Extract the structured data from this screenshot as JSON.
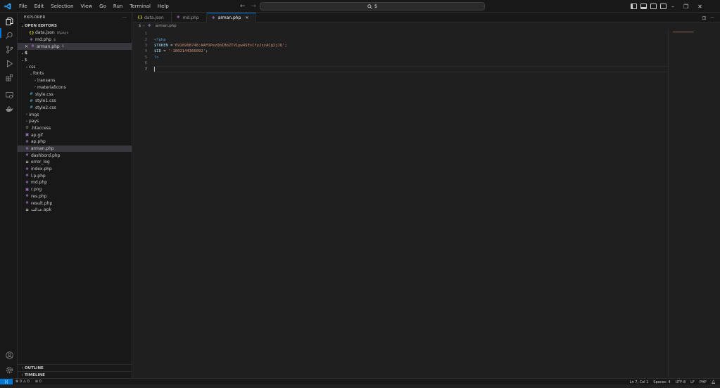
{
  "titlebar": {
    "menu": [
      "File",
      "Edit",
      "Selection",
      "View",
      "Go",
      "Run",
      "Terminal",
      "Help"
    ],
    "search_text": "$"
  },
  "sidebar": {
    "title": "EXPLORER",
    "open_editors_label": "OPEN EDITORS",
    "open_editors": [
      {
        "name": "data.json",
        "icon": "json-icon",
        "badge": "$\\pays",
        "active": false
      },
      {
        "name": "md.php",
        "icon": "php-icon",
        "badge": "$",
        "active": false
      },
      {
        "name": "arman.php",
        "icon": "php-icon",
        "badge": "$",
        "active": true
      }
    ],
    "workspace_label": "$",
    "tree": [
      {
        "name": "$",
        "indent": 1,
        "kind": "folder-open",
        "icon": ""
      },
      {
        "name": "css",
        "indent": 2,
        "kind": "folder-open",
        "icon": ""
      },
      {
        "name": "fonts",
        "indent": 3,
        "kind": "folder-open",
        "icon": ""
      },
      {
        "name": "iransans",
        "indent": 4,
        "kind": "folder-closed",
        "icon": ""
      },
      {
        "name": "materialicons",
        "indent": 4,
        "kind": "folder-closed",
        "icon": ""
      },
      {
        "name": "style.css",
        "indent": 3,
        "kind": "file",
        "icon": "css"
      },
      {
        "name": "style1.css",
        "indent": 3,
        "kind": "file",
        "icon": "css"
      },
      {
        "name": "style2.css",
        "indent": 3,
        "kind": "file",
        "icon": "css"
      },
      {
        "name": "imgs",
        "indent": 2,
        "kind": "folder-closed",
        "icon": ""
      },
      {
        "name": "pays",
        "indent": 2,
        "kind": "folder-closed",
        "icon": ""
      },
      {
        "name": ".htaccess",
        "indent": 2,
        "kind": "file",
        "icon": "gear"
      },
      {
        "name": "ap.gif",
        "indent": 2,
        "kind": "file",
        "icon": "img"
      },
      {
        "name": "ap.php",
        "indent": 2,
        "kind": "file",
        "icon": "php"
      },
      {
        "name": "arman.php",
        "indent": 2,
        "kind": "file",
        "icon": "php",
        "selected": true
      },
      {
        "name": "dashbord.php",
        "indent": 2,
        "kind": "file",
        "icon": "php"
      },
      {
        "name": "error_log",
        "indent": 2,
        "kind": "file",
        "icon": "text"
      },
      {
        "name": "index.php",
        "indent": 2,
        "kind": "file",
        "icon": "php"
      },
      {
        "name": "l.p.php",
        "indent": 2,
        "kind": "file",
        "icon": "php"
      },
      {
        "name": "md.php",
        "indent": 2,
        "kind": "file",
        "icon": "php"
      },
      {
        "name": "r.png",
        "indent": 2,
        "kind": "file",
        "icon": "img"
      },
      {
        "name": "res.php",
        "indent": 2,
        "kind": "file",
        "icon": "php"
      },
      {
        "name": "result.php",
        "indent": 2,
        "kind": "file",
        "icon": "php"
      },
      {
        "name": "عدالت.apk",
        "indent": 2,
        "kind": "file",
        "icon": "text"
      }
    ],
    "outline_label": "OUTLINE",
    "timeline_label": "TIMELINE"
  },
  "editor": {
    "tabs": [
      {
        "name": "data.json",
        "icon": "json",
        "active": false
      },
      {
        "name": "md.php",
        "icon": "php",
        "active": false
      },
      {
        "name": "arman.php",
        "icon": "php",
        "active": true
      }
    ],
    "breadcrumb": [
      "$",
      "arman.php"
    ],
    "lines": [
      {
        "n": "1",
        "tokens": []
      },
      {
        "n": "2",
        "tokens": [
          {
            "t": "<?php",
            "c": "tag"
          }
        ]
      },
      {
        "n": "3",
        "tokens": [
          {
            "t": "$TOKEN",
            "c": "var"
          },
          {
            "t": " =",
            "c": "op"
          },
          {
            "t": "'6916908748:AAFOPezQbIBbZTV1pw4SEsCfyJzzACg2jJQ'",
            "c": "str"
          },
          {
            "t": ";",
            "c": "op"
          }
        ]
      },
      {
        "n": "4",
        "tokens": [
          {
            "t": "$ID",
            "c": "var"
          },
          {
            "t": " = ",
            "c": "op"
          },
          {
            "t": "'-1002144366092'",
            "c": "str"
          },
          {
            "t": ";",
            "c": "op"
          }
        ]
      },
      {
        "n": "5",
        "tokens": [
          {
            "t": "?>",
            "c": "tag"
          }
        ]
      },
      {
        "n": "6",
        "tokens": []
      },
      {
        "n": "7",
        "tokens": [],
        "current": true
      }
    ]
  },
  "statusbar": {
    "errors": "0",
    "warnings": "0",
    "ports": "0",
    "position": "Ln 7, Col 1",
    "spaces": "Spaces: 4",
    "encoding": "UTF-8",
    "eol": "LF",
    "language": "PHP"
  },
  "colors": {
    "accent": "#0078d4",
    "php_icon": "#a074c4",
    "css_icon": "#519aba",
    "json_icon": "#cbcb41"
  }
}
